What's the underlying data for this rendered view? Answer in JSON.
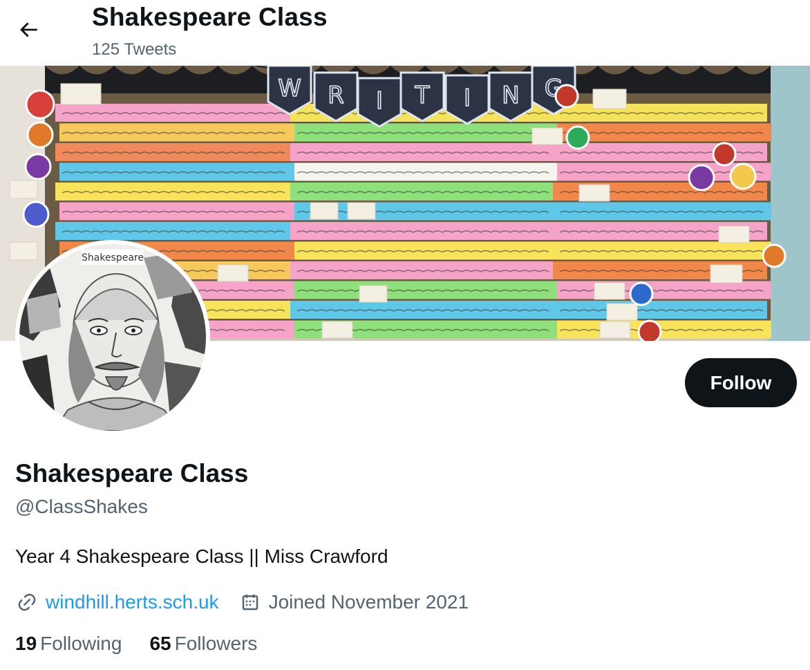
{
  "header": {
    "title": "Shakespeare Class",
    "tweet_count": "125 Tweets",
    "back_icon": "arrow-left-icon"
  },
  "banner": {
    "bunting_letters": [
      "W",
      "R",
      "I",
      "T",
      "I",
      "N",
      "G"
    ]
  },
  "avatar": {
    "caption": "Shakespeare"
  },
  "profile": {
    "follow_label": "Follow",
    "name": "Shakespeare Class",
    "handle": "@ClassShakes",
    "bio": "Year 4 Shakespeare Class || Miss Crawford",
    "website": "windhill.herts.sch.uk",
    "joined": "Joined November 2021",
    "link_icon": "link-icon",
    "calendar_icon": "calendar-icon"
  },
  "stats": {
    "following_count": "19",
    "following_label": "Following",
    "followers_count": "65",
    "followers_label": "Followers"
  },
  "colors": {
    "accent": "#1d9bf0",
    "text": "#0f1419",
    "muted": "#536471",
    "button": "#0f1419"
  }
}
